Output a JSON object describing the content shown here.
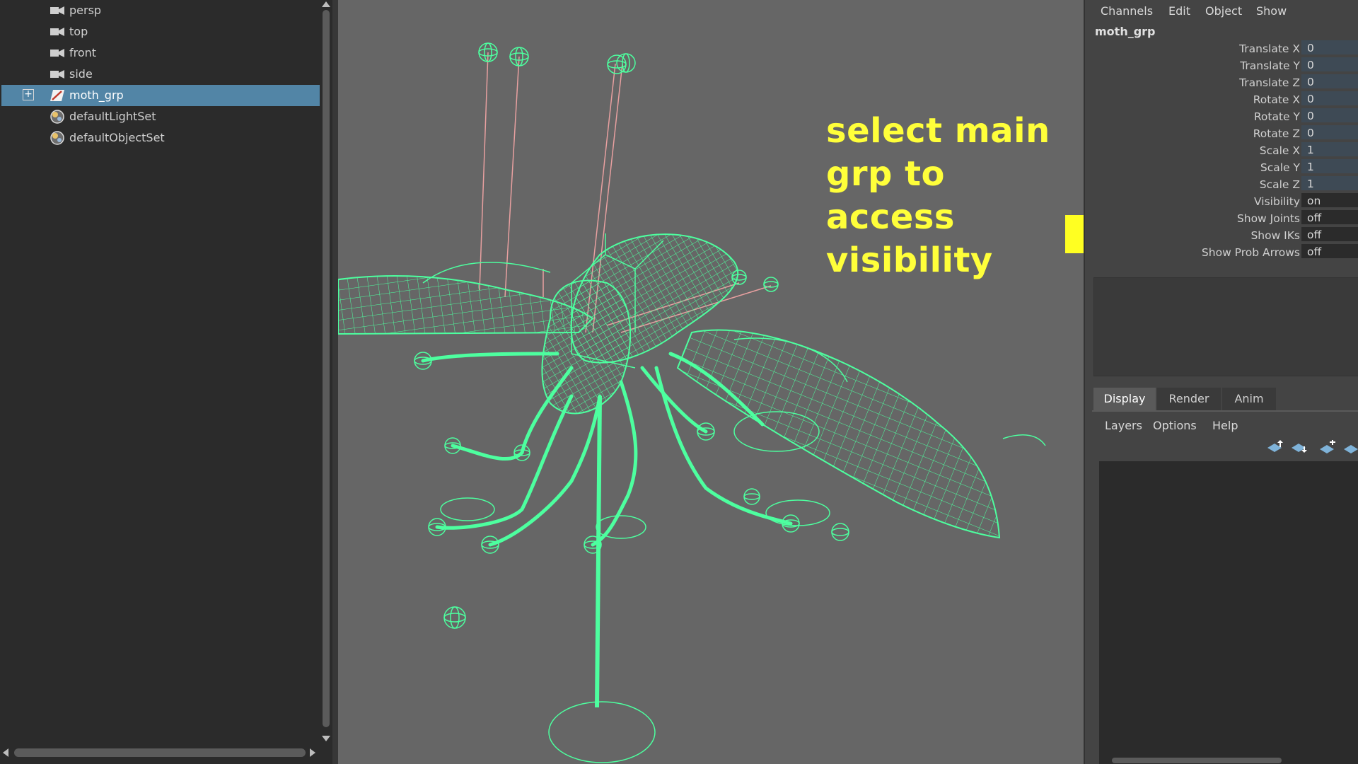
{
  "outliner": {
    "items": [
      {
        "label": "persp",
        "icon": "camera-icon"
      },
      {
        "label": "top",
        "icon": "camera-icon"
      },
      {
        "label": "front",
        "icon": "camera-icon"
      },
      {
        "label": "side",
        "icon": "camera-icon"
      },
      {
        "label": "moth_grp",
        "icon": "transform-group-icon",
        "selected": true,
        "expandable": true
      },
      {
        "label": "defaultLightSet",
        "icon": "set-icon"
      },
      {
        "label": "defaultObjectSet",
        "icon": "set-icon"
      }
    ],
    "expand_symbol": "+"
  },
  "viewport": {
    "callout_text": "select main grp to access visibility",
    "wire_color": "#4dff9f",
    "joint_color": "#e8a0a0"
  },
  "channel_box": {
    "menu": [
      "Channels",
      "Edit",
      "Object",
      "Show"
    ],
    "object_name": "moth_grp",
    "attributes": [
      {
        "label": "Translate X",
        "value": "0",
        "type": "num"
      },
      {
        "label": "Translate Y",
        "value": "0",
        "type": "num"
      },
      {
        "label": "Translate Z",
        "value": "0",
        "type": "num"
      },
      {
        "label": "Rotate X",
        "value": "0",
        "type": "num"
      },
      {
        "label": "Rotate Y",
        "value": "0",
        "type": "num"
      },
      {
        "label": "Rotate Z",
        "value": "0",
        "type": "num"
      },
      {
        "label": "Scale X",
        "value": "1",
        "type": "num"
      },
      {
        "label": "Scale Y",
        "value": "1",
        "type": "num"
      },
      {
        "label": "Scale Z",
        "value": "1",
        "type": "num"
      },
      {
        "label": "Visibility",
        "value": "on",
        "type": "enum"
      },
      {
        "label": "Show Joints",
        "value": "off",
        "type": "enum"
      },
      {
        "label": "Show IKs",
        "value": "off",
        "type": "enum"
      },
      {
        "label": "Show Prob Arrows",
        "value": "off",
        "type": "enum"
      }
    ]
  },
  "layer_editor": {
    "tabs": [
      {
        "label": "Display",
        "active": true
      },
      {
        "label": "Render",
        "active": false
      },
      {
        "label": "Anim",
        "active": false
      }
    ],
    "menu": [
      "Layers",
      "Options",
      "Help"
    ],
    "tools": [
      "move-layer-up-icon",
      "move-layer-down-icon",
      "new-layer-icon",
      "new-layer-from-selected-icon"
    ]
  },
  "annotation": {
    "arrow_color": "#ffff22",
    "text_color": "#ffff3a"
  }
}
